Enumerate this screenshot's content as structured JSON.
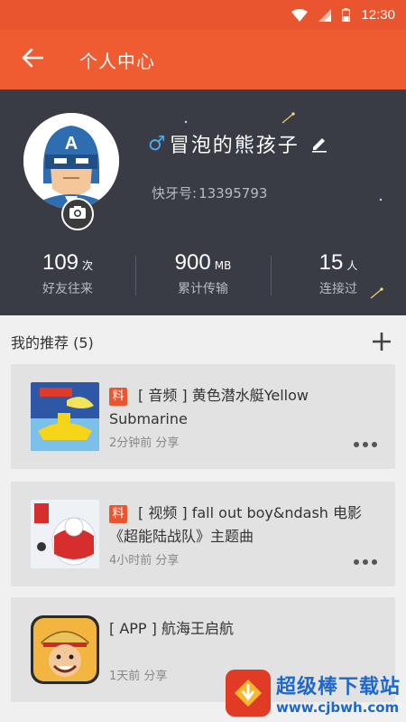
{
  "status_bar": {
    "time": "12:30",
    "icons": [
      "wifi-icon",
      "signal-icon",
      "battery-icon"
    ]
  },
  "app_bar": {
    "title": "个人中心",
    "back_icon": "arrow-left-icon"
  },
  "profile": {
    "gender_symbol": "♂",
    "nickname": "冒泡的熊孩子",
    "bt_label": "快牙号:",
    "bt_id": "13395793",
    "avatar_letter": "A",
    "stats": [
      {
        "value": "109",
        "unit": "次",
        "label": "好友往来"
      },
      {
        "value": "900",
        "unit": "MB",
        "label": "累计传输"
      },
      {
        "value": "15",
        "unit": "人",
        "label": "连接过"
      }
    ]
  },
  "recommend": {
    "title": "我的推荐 (5)",
    "items": [
      {
        "badge": "料",
        "title": "[ 音频 ] 黄色潜水艇Yellow Submarine",
        "meta": "2分钟前 分享"
      },
      {
        "badge": "料",
        "title": "[ 视频 ] fall out boy&ndash 电影《超能陆战队》主题曲",
        "meta": "4小时前 分享"
      },
      {
        "badge": "",
        "title": "[ APP ] 航海王启航",
        "meta": "1天前 分享"
      }
    ]
  },
  "watermark": {
    "title": "超级棒下载站",
    "url": "www.cjbwh.com"
  },
  "colors": {
    "accent": "#f05c32",
    "status_bar": "#e8552f",
    "header_bg": "#393c45",
    "gender": "#4aa8f0"
  }
}
